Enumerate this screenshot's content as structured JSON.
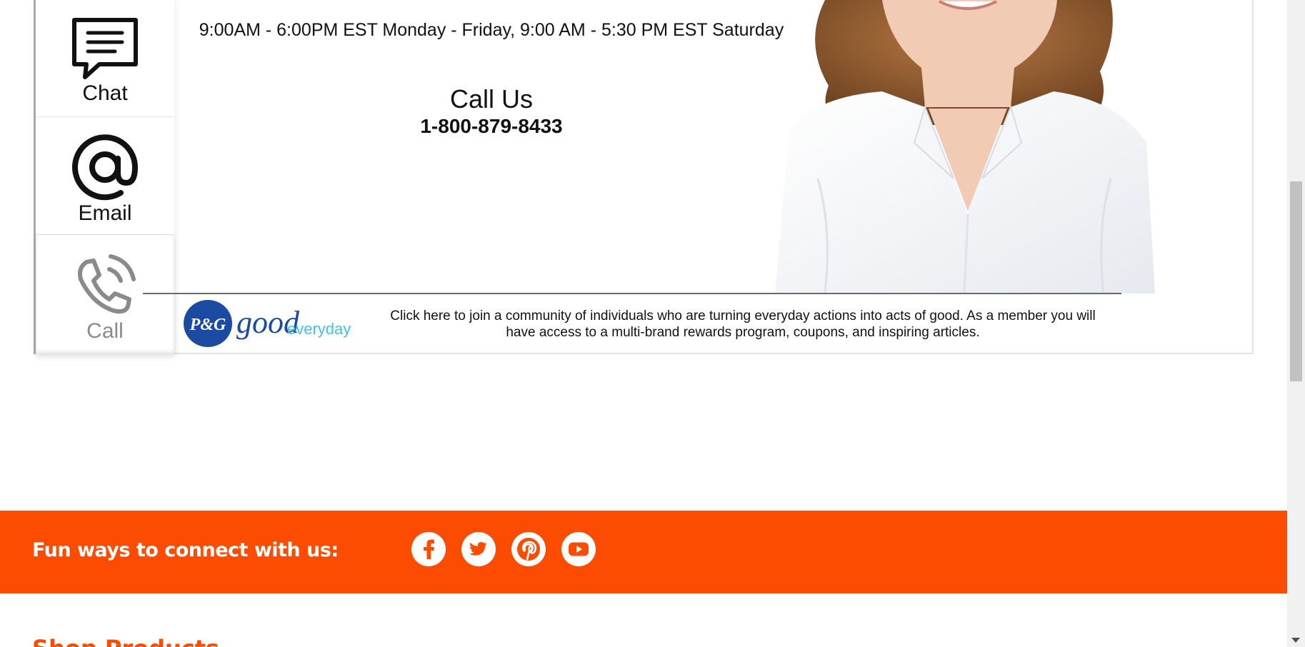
{
  "contact": {
    "tabs": [
      {
        "label": "Chat",
        "icon": "chat-bubble-icon"
      },
      {
        "label": "Email",
        "icon": "at-sign-icon"
      },
      {
        "label": "Call",
        "icon": "phone-icon",
        "selected": true
      }
    ],
    "hours": "9:00AM - 6:00PM EST Monday - Friday, 9:00 AM - 5:30 PM EST Saturday",
    "call_heading": "Call Us",
    "phone_number": "1-800-879-8433"
  },
  "good_everyday": {
    "logo_brand": "P&G",
    "logo_script": "good",
    "logo_word": "everyday",
    "text": "Click here to join a community of individuals who are turning everyday actions into acts of good. As a member you will have access to a multi-brand rewards program, coupons, and inspiring articles."
  },
  "social": {
    "heading": "Fun ways to connect with us:",
    "icons": [
      "facebook-icon",
      "twitter-icon",
      "pinterest-icon",
      "youtube-icon"
    ],
    "bar_color": "#fc4c02"
  },
  "footer": {
    "shop_heading": "Shop Products"
  }
}
